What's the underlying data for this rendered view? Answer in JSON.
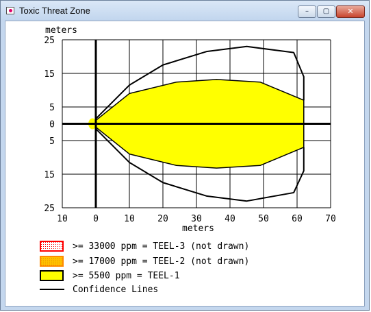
{
  "window": {
    "title": "Toxic Threat Zone",
    "icons": {
      "app": "toxic-zone-app-icon",
      "minimize": "minimize-icon",
      "maximize": "maximize-icon",
      "close": "close-icon"
    }
  },
  "chart_data": {
    "type": "area",
    "xlabel": "meters",
    "ylabel": "meters",
    "xlim": [
      -10,
      70
    ],
    "ylim": [
      -25,
      25
    ],
    "x_ticks": [
      {
        "value": -10,
        "label": "10"
      },
      {
        "value": 0,
        "label": "0"
      },
      {
        "value": 10,
        "label": "10"
      },
      {
        "value": 20,
        "label": "20"
      },
      {
        "value": 30,
        "label": "30"
      },
      {
        "value": 40,
        "label": "40"
      },
      {
        "value": 50,
        "label": "50"
      },
      {
        "value": 60,
        "label": "60"
      },
      {
        "value": 70,
        "label": "70"
      }
    ],
    "y_ticks": [
      {
        "value": 25,
        "label": "25"
      },
      {
        "value": 15,
        "label": "15"
      },
      {
        "value": 5,
        "label": "5"
      },
      {
        "value": 0,
        "label": "0"
      },
      {
        "value": -5,
        "label": "5"
      },
      {
        "value": -15,
        "label": "15"
      },
      {
        "value": -25,
        "label": "25"
      }
    ],
    "x_grid": [
      -10,
      0,
      10,
      20,
      30,
      40,
      50,
      60,
      70
    ],
    "y_grid": [
      25,
      15,
      5,
      -5,
      -15,
      -25
    ],
    "grid": true,
    "legend_position": "bottom-left",
    "threat_zone": {
      "color": "#ffff00",
      "source_x": -1,
      "upper": [
        [
          0,
          1
        ],
        [
          10,
          9
        ],
        [
          24,
          12.4
        ],
        [
          36,
          13.2
        ],
        [
          49,
          12.4
        ],
        [
          56,
          9.5
        ],
        [
          62,
          7
        ]
      ],
      "lower": [
        [
          0,
          -1
        ],
        [
          10,
          -9
        ],
        [
          24,
          -12.4
        ],
        [
          36,
          -13.2
        ],
        [
          49,
          -12.4
        ],
        [
          56,
          -9.5
        ],
        [
          62,
          -7
        ]
      ]
    },
    "confidence_lines": {
      "upper": [
        [
          0,
          1.5
        ],
        [
          10,
          11.5
        ],
        [
          20,
          17.5
        ],
        [
          33,
          21.5
        ],
        [
          45,
          23
        ],
        [
          59,
          21.2
        ],
        [
          62,
          14
        ],
        [
          62,
          7
        ]
      ],
      "lower": [
        [
          0,
          -1.5
        ],
        [
          10,
          -11.5
        ],
        [
          20,
          -17.5
        ],
        [
          33,
          -21.5
        ],
        [
          45,
          -23
        ],
        [
          59,
          -20.5
        ],
        [
          62,
          -14
        ],
        [
          62,
          -7
        ]
      ]
    },
    "legend": [
      {
        "label": ">= 33000 ppm = TEEL-3 (not drawn)",
        "fill": "#ffffff",
        "border": "#ff0000",
        "pattern": "dots",
        "icon": "red-dotted-swatch"
      },
      {
        "label": ">= 17000 ppm = TEEL-2 (not drawn)",
        "fill": "#ffc000",
        "border": "#ff8c00",
        "pattern": "dots",
        "icon": "orange-dotted-swatch"
      },
      {
        "label": ">= 5500 ppm = TEEL-1",
        "fill": "#ffff00",
        "border": "#000000",
        "pattern": "solid",
        "icon": "yellow-solid-swatch"
      },
      {
        "label": "Confidence Lines",
        "fill": "none",
        "border": "#000000",
        "pattern": "line",
        "icon": "black-line-swatch"
      }
    ]
  }
}
